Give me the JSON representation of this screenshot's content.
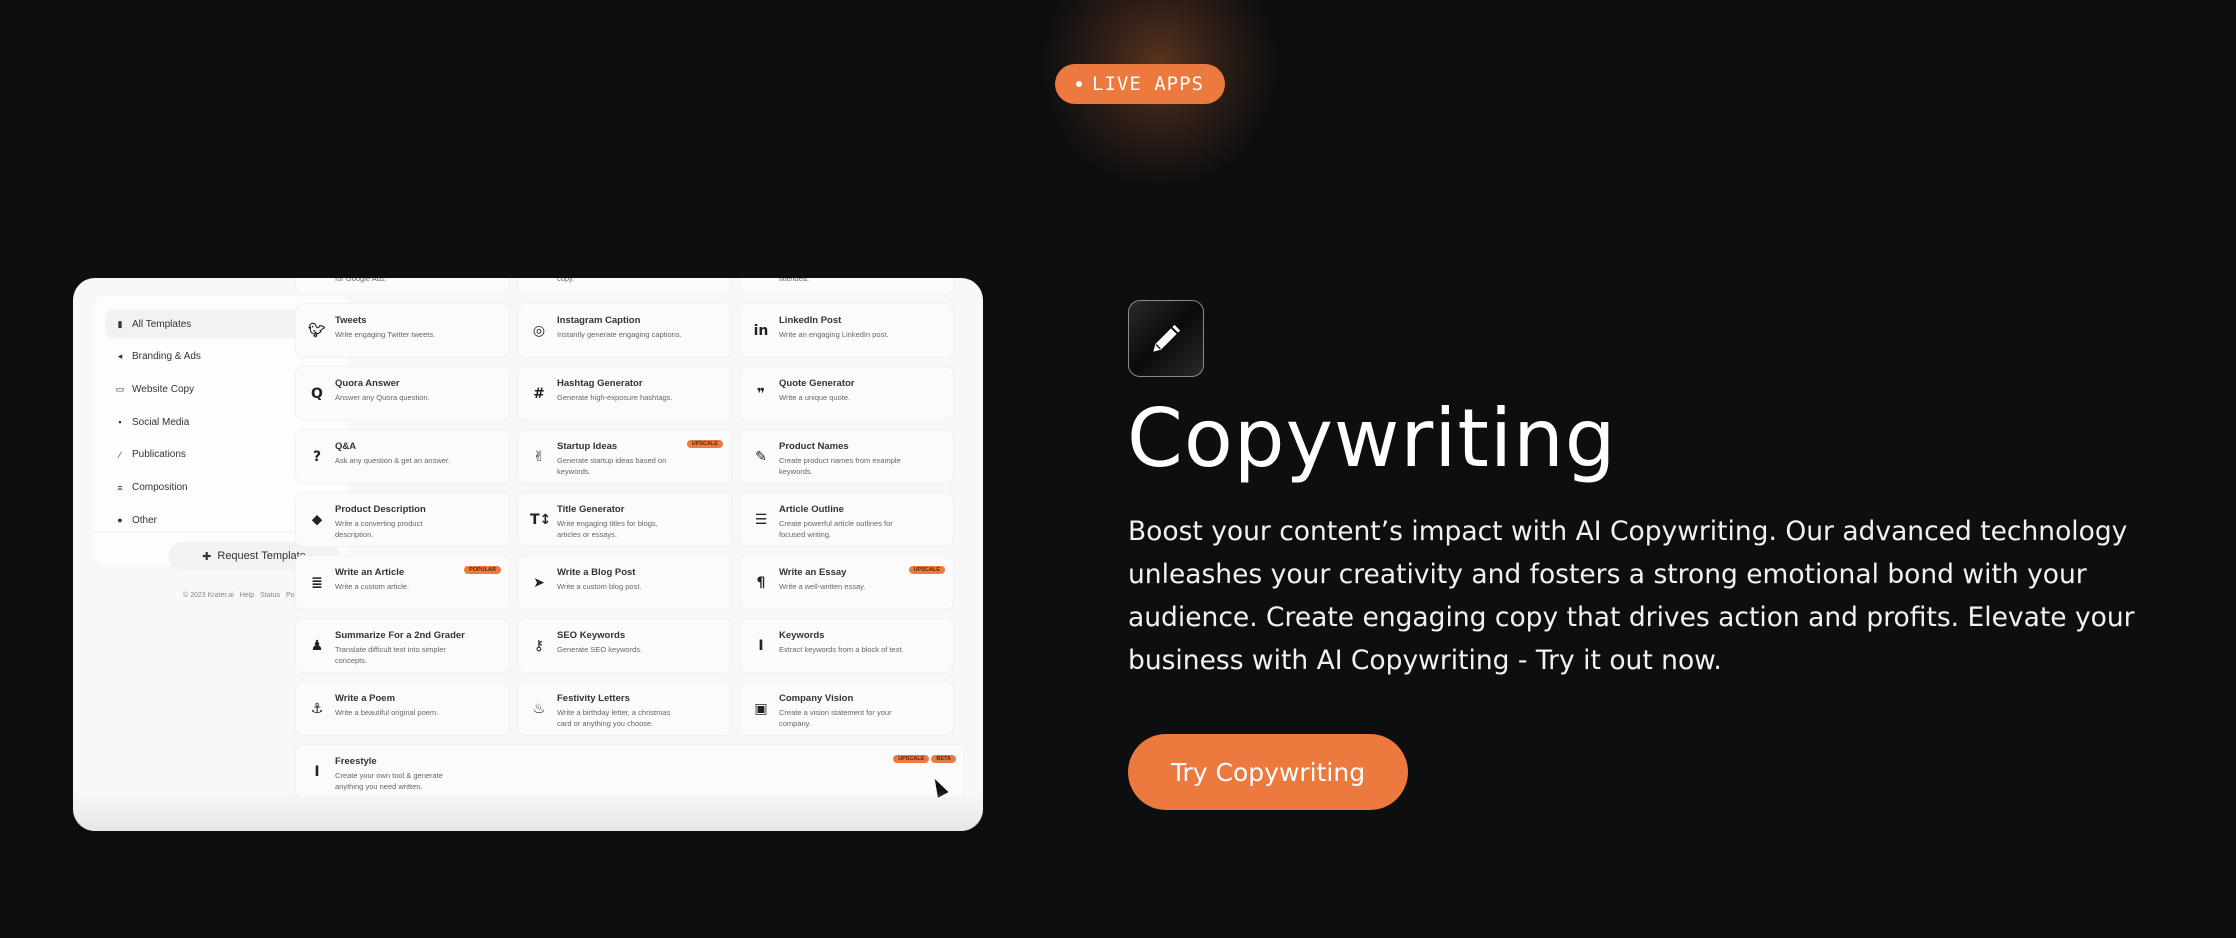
{
  "hero_badge": {
    "label": "LIVE APPS"
  },
  "app_preview": {
    "sidebar": {
      "items": [
        {
          "label": "All Templates",
          "icon": "book-icon",
          "glyph": "▮",
          "active": true
        },
        {
          "label": "Branding & Ads",
          "icon": "megaphone-icon",
          "glyph": "◂"
        },
        {
          "label": "Website Copy",
          "icon": "laptop-icon",
          "glyph": "▭"
        },
        {
          "label": "Social Media",
          "icon": "facebook-icon",
          "glyph": "▪"
        },
        {
          "label": "Publications",
          "icon": "paperclip-icon",
          "glyph": "∕"
        },
        {
          "label": "Composition",
          "icon": "align-left-icon",
          "glyph": "≡"
        },
        {
          "label": "Other",
          "icon": "globe-icon",
          "glyph": "●"
        }
      ],
      "request_button": "Request Template",
      "request_icon_glyph": "✚",
      "footer": [
        "© 2023 Krater.ai",
        "Help",
        "Status",
        "Policies"
      ]
    },
    "top_row_partial": [
      "for Google Ads.",
      "copy.",
      "title/idea."
    ],
    "templates": [
      {
        "title": "Tweets",
        "desc": "Write engaging Twitter tweets.",
        "icon": "twitter-icon",
        "glyph": "🐦︎",
        "badges": []
      },
      {
        "title": "Instagram Caption",
        "desc": "Instantly generate engaging captions.",
        "icon": "instagram-icon",
        "glyph": "◎",
        "badges": []
      },
      {
        "title": "LinkedIn Post",
        "desc": "Write an engaging LinkedIn post.",
        "icon": "linkedin-icon",
        "glyph": "in",
        "badges": []
      },
      {
        "title": "Quora Answer",
        "desc": "Answer any Quora question.",
        "icon": "quora-icon",
        "glyph": "Q",
        "badges": []
      },
      {
        "title": "Hashtag Generator",
        "desc": "Generate high-exposure hashtags.",
        "icon": "hashtag-icon",
        "glyph": "#",
        "badges": []
      },
      {
        "title": "Quote Generator",
        "desc": "Write a unique quote.",
        "icon": "quote-icon",
        "glyph": "❞",
        "badges": []
      },
      {
        "title": "Q&A",
        "desc": "Ask any question & get an answer.",
        "icon": "question-circle-icon",
        "glyph": "?",
        "badges": []
      },
      {
        "title": "Startup Ideas",
        "desc": "Generate startup ideas based on keywords.",
        "icon": "victory-hand-icon",
        "glyph": "✌",
        "badges": [
          "UPSCALE"
        ]
      },
      {
        "title": "Product Names",
        "desc": "Create product names from example keywords.",
        "icon": "edit-icon",
        "glyph": "✎",
        "badges": []
      },
      {
        "title": "Product Description",
        "desc": "Write a converting product description.",
        "icon": "tag-icon",
        "glyph": "⬥",
        "badges": []
      },
      {
        "title": "Title Generator",
        "desc": "Write engaging titles for blogs, articles or essays.",
        "icon": "text-height-icon",
        "glyph": "T↕",
        "badges": []
      },
      {
        "title": "Article Outline",
        "desc": "Create powerful article outlines for focused writing.",
        "icon": "list-ol-icon",
        "glyph": "☰",
        "badges": []
      },
      {
        "title": "Write an Article",
        "desc": "Write a custom article.",
        "icon": "bars-icon",
        "glyph": "≣",
        "badges": [
          "POPULAR"
        ]
      },
      {
        "title": "Write a Blog Post",
        "desc": "Write a custom blog post.",
        "icon": "paper-plane-icon",
        "glyph": "➤",
        "badges": []
      },
      {
        "title": "Write an Essay",
        "desc": "Write a well-written essay.",
        "icon": "paragraph-icon",
        "glyph": "¶",
        "badges": [
          "UPSCALE"
        ]
      },
      {
        "title": "Summarize For a 2nd Grader",
        "desc": "Translate difficult text into simpler concepts.",
        "icon": "child-icon",
        "glyph": "♟",
        "badges": []
      },
      {
        "title": "SEO Keywords",
        "desc": "Generate SEO keywords.",
        "icon": "key-icon",
        "glyph": "⚷",
        "badges": []
      },
      {
        "title": "Keywords",
        "desc": "Extract keywords from a block of text.",
        "icon": "italic-icon",
        "glyph": "I",
        "badges": []
      },
      {
        "title": "Write a Poem",
        "desc": "Write a beautiful original poem.",
        "icon": "anchor-icon",
        "glyph": "⚓",
        "badges": []
      },
      {
        "title": "Festivity Letters",
        "desc": "Write a birthday letter, a christmas card or anything you choose.",
        "icon": "birthday-cake-icon",
        "glyph": "♨",
        "badges": []
      },
      {
        "title": "Company Vision",
        "desc": "Create a vision statement for your company.",
        "icon": "briefcase-icon",
        "glyph": "▣",
        "badges": []
      }
    ],
    "freestyle": {
      "title": "Freestyle",
      "desc": "Create your own tool & generate anything you need written.",
      "icon": "i-cursor-icon",
      "glyph": "I",
      "badges": [
        "UPSCALE",
        "BETA"
      ]
    }
  },
  "product": {
    "icon": "pencil-icon",
    "title": "Copywriting",
    "description": "Boost your content’s impact with AI Copywriting. Our advanced technology unleashes your creativity and fosters a strong emotional bond with your audience. Create engaging copy that drives action and profits. Elevate your business with AI Copywriting - Try it out now.",
    "cta_label": "Try Copywriting"
  },
  "colors": {
    "accent": "#ec7a3e",
    "background": "#0d0e10",
    "card": "#f8f8fa"
  }
}
